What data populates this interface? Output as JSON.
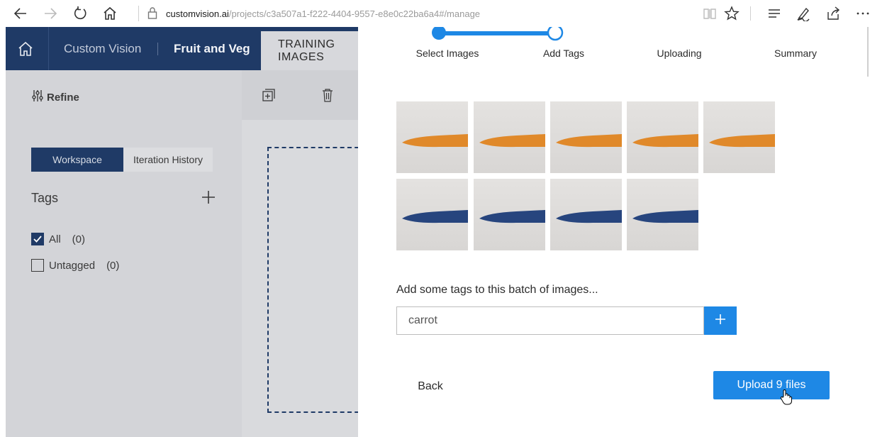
{
  "browser": {
    "url_domain": "customvision.ai",
    "url_path": "/projects/c3a507a1-f222-4404-9557-e8e0c22ba6a4#/manage"
  },
  "app": {
    "brand": "Custom Vision",
    "project": "Fruit and Veg",
    "active_tab": "TRAINING IMAGES",
    "refine_label": "Refine",
    "workspace_label": "Workspace",
    "iteration_history_label": "Iteration History",
    "tags_title": "Tags",
    "tags": [
      {
        "label": "All",
        "count": "(0)",
        "checked": true
      },
      {
        "label": "Untagged",
        "count": "(0)",
        "checked": false
      }
    ]
  },
  "wizard": {
    "steps": [
      "Select Images",
      "Add Tags",
      "Uploading",
      "Summary"
    ],
    "current_step": 2,
    "tags_prompt": "Add some tags to this batch of images...",
    "tag_input_value": "carrot",
    "back_label": "Back",
    "upload_label": "Upload 9 files",
    "thumbnails": [
      {
        "name": "orange-carrot-1",
        "color": "#e0892a"
      },
      {
        "name": "orange-carrot-2",
        "color": "#e0892a"
      },
      {
        "name": "orange-carrot-3",
        "color": "#e0892a"
      },
      {
        "name": "orange-carrot-4",
        "color": "#e0892a"
      },
      {
        "name": "orange-carrot-5",
        "color": "#e0892a"
      },
      {
        "name": "blue-carrot-1",
        "color": "#27457e"
      },
      {
        "name": "blue-carrot-2",
        "color": "#27457e"
      },
      {
        "name": "blue-carrot-3",
        "color": "#27457e"
      },
      {
        "name": "blue-carrot-4",
        "color": "#27457e"
      }
    ]
  },
  "colors": {
    "accent": "#1e88e5",
    "header": "#1f3a66",
    "checkbox": "#1f3a66"
  }
}
